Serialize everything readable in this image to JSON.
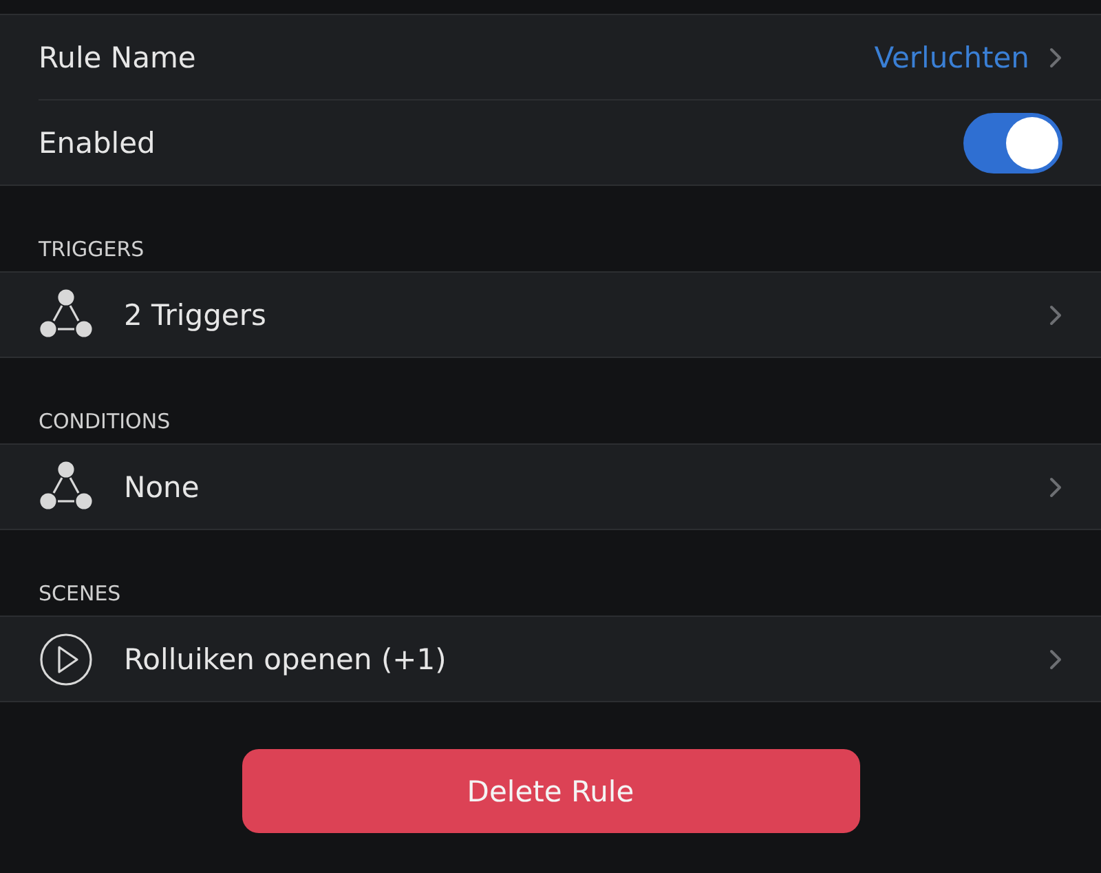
{
  "settings": [
    {
      "kind": "value",
      "label": "Rule Name",
      "value": "Verluchten"
    },
    {
      "kind": "toggle",
      "label": "Enabled",
      "on": true
    }
  ],
  "sections": [
    {
      "header": "TRIGGERS",
      "item": {
        "kind": "graph",
        "label": "2 Triggers"
      }
    },
    {
      "header": "CONDITIONS",
      "item": {
        "kind": "graph",
        "label": "None"
      }
    },
    {
      "header": "SCENES",
      "item": {
        "kind": "play",
        "label": "Rolluiken openen (+1)"
      }
    }
  ],
  "delete_button": "Delete Rule"
}
